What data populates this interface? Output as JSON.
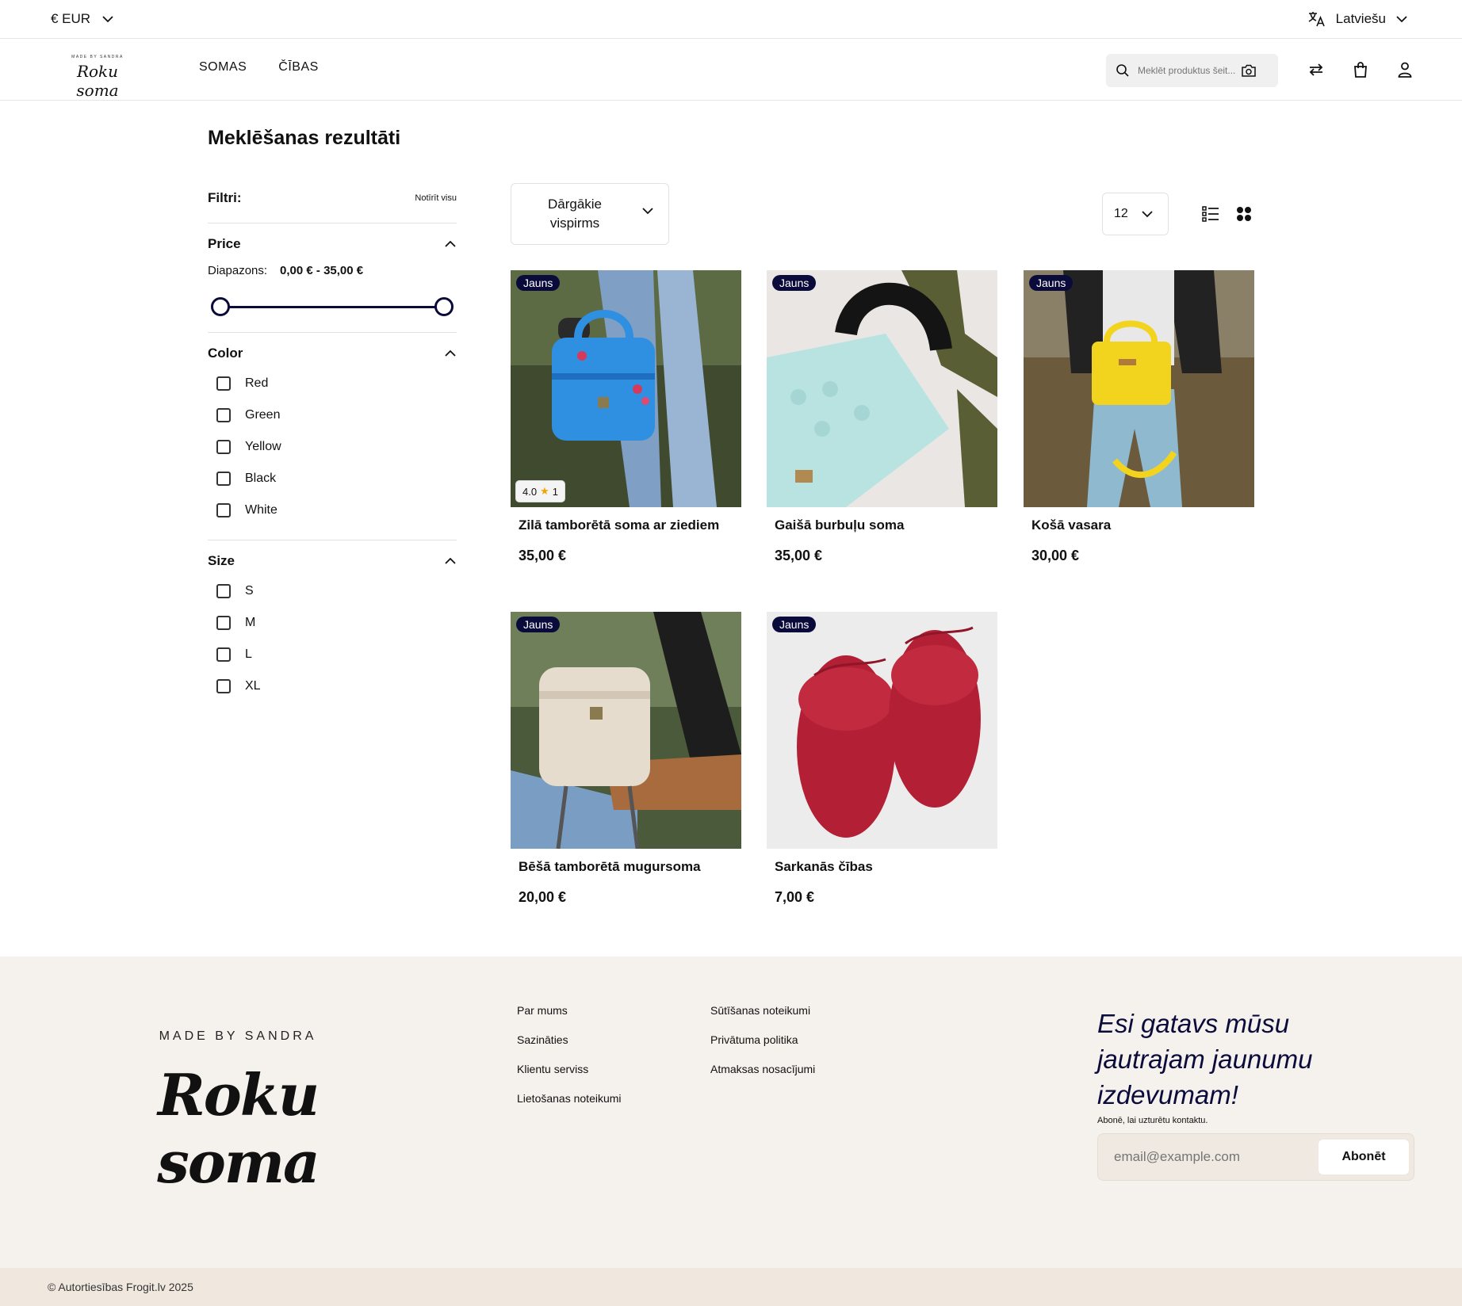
{
  "topbar": {
    "currency": "€ EUR",
    "language": "Latviešu"
  },
  "header": {
    "logo_small": "MADE BY SANDRA",
    "logo_script": "Roku soma",
    "nav": [
      "SOMAS",
      "ČĪBAS"
    ],
    "search_placeholder": "Meklēt produktus šeit..."
  },
  "main": {
    "title": "Meklēšanas rezultāti",
    "filters": {
      "label": "Filtri:",
      "clear": "Notīrīt visu",
      "price": {
        "label": "Price",
        "range_label": "Diapazons:",
        "range_value": "0,00 € - 35,00 €",
        "min": 0,
        "max": 35
      },
      "color": {
        "label": "Color",
        "options": [
          "Red",
          "Green",
          "Yellow",
          "Black",
          "White"
        ]
      },
      "size": {
        "label": "Size",
        "options": [
          "S",
          "M",
          "L",
          "XL"
        ]
      }
    },
    "sort": "Dārgākie vispirms",
    "per_page": "12",
    "products": [
      {
        "name": "Zilā tamborētā soma ar ziediem",
        "price": "35,00 €",
        "badge": "Jauns",
        "rating": "4.0",
        "reviews": "1"
      },
      {
        "name": "Gaišā burbuļu soma",
        "price": "35,00 €",
        "badge": "Jauns"
      },
      {
        "name": "Košā vasara",
        "price": "30,00 €",
        "badge": "Jauns"
      },
      {
        "name": "Bēšā tamborētā mugursoma",
        "price": "20,00 €",
        "badge": "Jauns"
      },
      {
        "name": "Sarkanās čības",
        "price": "7,00 €",
        "badge": "Jauns"
      }
    ]
  },
  "footer": {
    "brand_small": "MADE BY SANDRA",
    "brand_script": "Roku soma",
    "links_col1": [
      "Par mums",
      "Sazināties",
      "Klientu serviss",
      "Lietošanas noteikumi"
    ],
    "links_col2": [
      "Sūtīšanas noteikumi",
      "Privātuma politika",
      "Atmaksas nosacījumi"
    ],
    "newsletter_title": "Esi gatavs mūsu jautrajam jaunumu izdevumam!",
    "newsletter_sub": "Abonē, lai uzturētu kontaktu.",
    "email_placeholder": "email@example.com",
    "subscribe": "Abonēt",
    "copyright": "© Autortiesības Frogit.lv 2025"
  },
  "colors": {
    "accent": "#0b0b3b",
    "footer_bg": "#f5f1ec"
  }
}
